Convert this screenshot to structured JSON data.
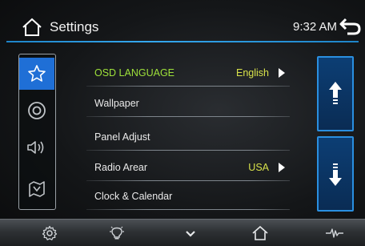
{
  "header": {
    "title": "Settings",
    "time": "9:32 AM"
  },
  "sidebar": {
    "items": [
      {
        "icon": "star-icon",
        "active": true
      },
      {
        "icon": "disc-icon",
        "active": false
      },
      {
        "icon": "speaker-icon",
        "active": false
      },
      {
        "icon": "map-icon",
        "active": false
      }
    ]
  },
  "menu": {
    "items": [
      {
        "label": "OSD LANGUAGE",
        "value": "English",
        "highlight": true,
        "has_arrow": true
      },
      {
        "label": "Wallpaper",
        "value": "",
        "highlight": false,
        "has_arrow": false
      },
      {
        "label": "Panel Adjust",
        "value": "",
        "highlight": false,
        "has_arrow": false
      },
      {
        "label": "Radio Arear",
        "value": "USA",
        "highlight": false,
        "has_arrow": true
      },
      {
        "label": "Clock & Calendar",
        "value": "",
        "highlight": false,
        "has_arrow": false
      }
    ]
  },
  "scroll": {
    "up_icon": "arrow-up-icon",
    "down_icon": "arrow-down-icon"
  },
  "bottombar": {
    "items": [
      "gear-icon",
      "bulb-icon",
      "chevron-down-icon",
      "home-icon",
      "waveform-icon"
    ]
  },
  "colors": {
    "accent_blue": "#1f6fd6",
    "highlight_green": "#9ee13a",
    "value_yellow": "#d8e24a"
  }
}
